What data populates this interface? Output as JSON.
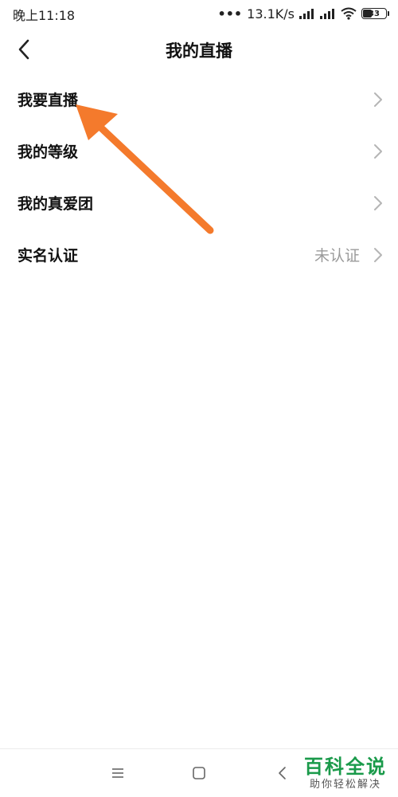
{
  "status_bar": {
    "time": "晚上11:18",
    "network_speed": "13.1K/s",
    "battery_level": "33"
  },
  "header": {
    "title": "我的直播",
    "back_icon": "chevron-left-icon"
  },
  "menu": {
    "items": [
      {
        "label": "我要直播",
        "value": ""
      },
      {
        "label": "我的等级",
        "value": ""
      },
      {
        "label": "我的真爱团",
        "value": ""
      },
      {
        "label": "实名认证",
        "value": "未认证"
      }
    ]
  },
  "annotation": {
    "arrow_color": "#f47a2c"
  },
  "nav_bar": {
    "menu_icon": "menu-lines-icon",
    "home_icon": "square-home-icon",
    "back_icon": "triangle-back-icon"
  },
  "watermark": {
    "title": "百科全说",
    "subtitle": "助你轻松解决"
  }
}
